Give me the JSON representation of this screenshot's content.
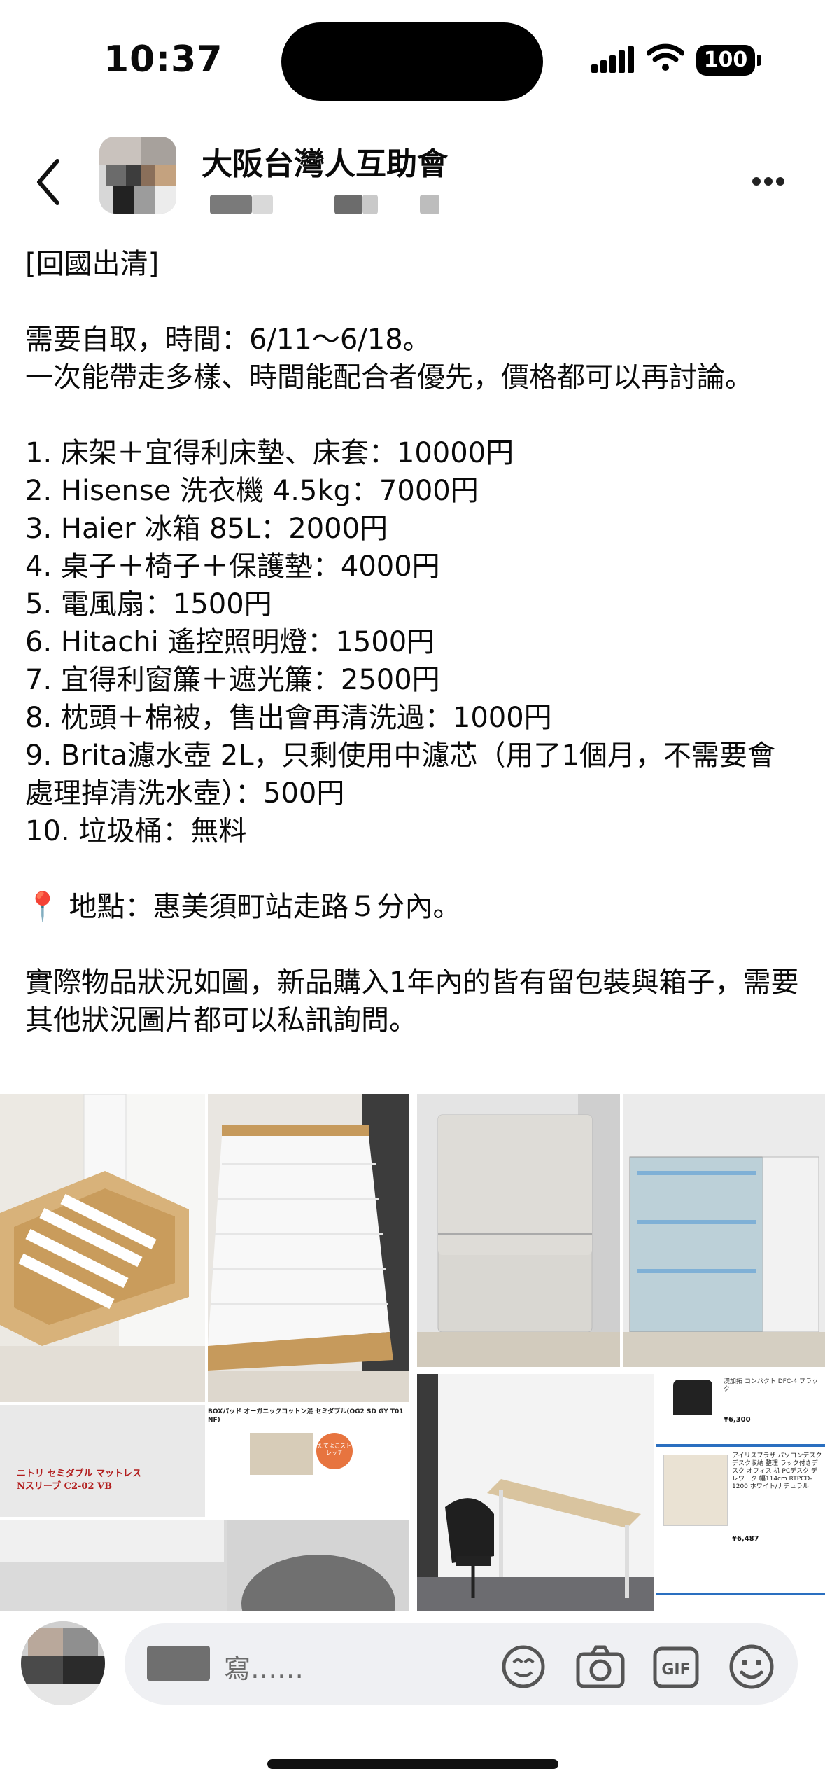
{
  "status_bar": {
    "time": "10:37",
    "battery": "100"
  },
  "header": {
    "group_name": "大阪台灣人互助會"
  },
  "post": {
    "text": "[回國出清]\n\n需要自取，時間：6/11～6/18。\n一次能帶走多樣、時間能配合者優先，價格都可以再討論。\n\n1. 床架＋宜得利床墊、床套：10000円\n2. Hisense 洗衣機 4.5kg：7000円\n3. Haier 冰箱 85L：2000円\n4. 桌子＋椅子＋保護墊：4000円\n5. 電風扇：1500円\n6. Hitachi 遙控照明燈：1500円\n7. 宜得利窗簾＋遮光簾：2500円\n8. 枕頭＋棉被，售出會再清洗過：1000円\n9. Brita濾水壺 2L，只剩使用中濾芯（用了1個月，不需要會處理掉清洗水壺）：500円\n10. 垃圾桶：無料\n\n📍 地點：惠美須町站走路５分內。\n\n實際物品狀況如圖，新品購入1年內的皆有留包裝與箱子，需要其他狀況圖片都可以私訊詢問。"
  },
  "photos": {
    "mattress_label": "ニトリ セミダブル マットレス\nNスリーブ C2-02 VB",
    "box_title": "BOXパッド オーガニックコットン混 セミダブル(OG2 SD GY T01 NF)",
    "box_badge": "たてよこストレッチ",
    "desk_listing_1": "アイリスプラザ パソコンデスク デスク収納 整理 ラック付きデスク オフィス 机 PCデスク デレワーク 幅114cm RTPCD-1200 ホワイト/ナチュラル",
    "desk_price_1": "¥6,487",
    "desk_listing_2": "澳加拓 コンパクト DFC-4 ブラック",
    "desk_price_2": "¥6,300"
  },
  "comment_bar": {
    "placeholder": "寫……"
  },
  "icons": {
    "back": "chevron-left-icon",
    "more": "more-dots-icon",
    "avatar_reaction": "avatar-sticker-icon",
    "camera": "camera-icon",
    "gif": "gif-icon",
    "emoji": "smiley-icon"
  }
}
